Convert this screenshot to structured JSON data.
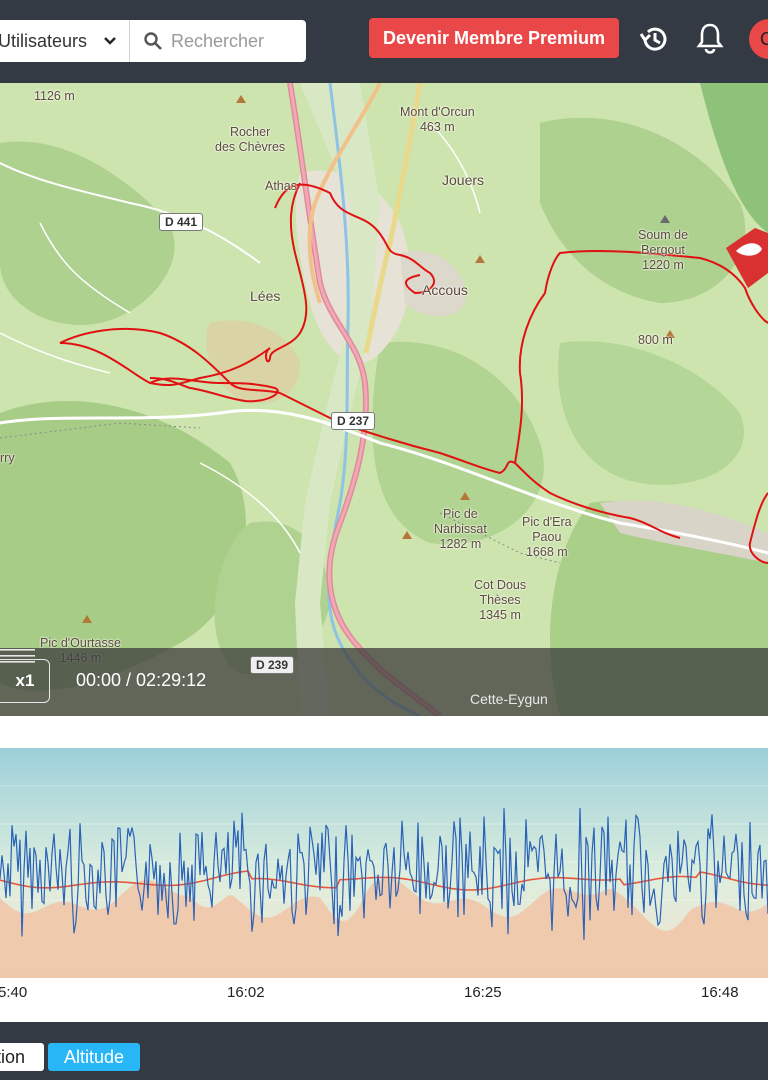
{
  "header": {
    "user_select_label": "Utilisateurs",
    "search_placeholder": "Rechercher",
    "premium_label": "Devenir Membre Premium",
    "avatar_initial": "C"
  },
  "map": {
    "labels": {
      "pic_1126": "1126 m",
      "rocher": "Rocher\ndes Chèvres",
      "athas": "Athas",
      "lees": "Lées",
      "mont_dorcun": "Mont d'Orcun\n463 m",
      "jouers": "Jouers",
      "accous": "Accous",
      "soum": "Soum de\nBergout\n1220 m",
      "m800": "800 m",
      "pic_narbissat": "Pic de\nNarbissat\n1282 m",
      "pic_era": "Pic d'Era\nPaou\n1668 m",
      "cot_dous": "Cot Dous\nThèses\n1345 m",
      "pic_ourtasse": "Pic d'Ourtasse\n1446 m",
      "cette_eygun": "Cette-Eygun",
      "rry": "rry"
    },
    "roads": {
      "d441": "D 441",
      "d237": "D 237",
      "d239": "D 239"
    }
  },
  "player": {
    "speed": "x1",
    "time": "00:00 / 02:29:12"
  },
  "chart_data": {
    "type": "line",
    "x_ticks": [
      "5:40",
      "16:02",
      "16:25",
      "16:48"
    ],
    "series": [
      {
        "values": []
      },
      {
        "values": []
      },
      {
        "values": []
      }
    ]
  },
  "bottom": {
    "tab_vario": "tion",
    "tab_altitude": "Altitude"
  },
  "colors": {
    "header_bg": "#343a44",
    "premium": "#e94748",
    "track": "#e01010",
    "vario_line": "#2a62b8",
    "alt_line": "#e8563a",
    "altitude_tag": "#29b6f6"
  }
}
